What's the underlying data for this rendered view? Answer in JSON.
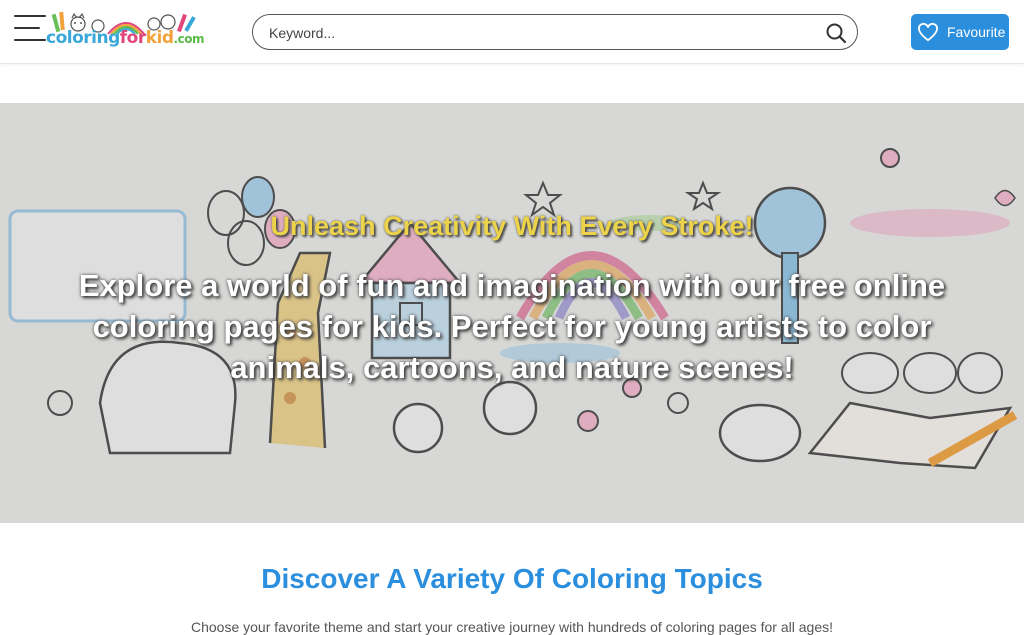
{
  "header": {
    "logo": {
      "text_parts": [
        "coloring",
        "for",
        "kid",
        ".com"
      ],
      "colors": [
        "#39a7d8",
        "#e0457b",
        "#f2a23a",
        "#58b947"
      ]
    },
    "search": {
      "placeholder": "Keyword...",
      "value": ""
    },
    "favourite_label": "Favourite"
  },
  "hero": {
    "tagline": "Unleash Creativity With Every Stroke!",
    "description": "Explore a world of fun and imagination with our free online coloring pages for kids. Perfect for young artists to color animals, cartoons, and nature scenes!"
  },
  "section": {
    "title": "Discover A Variety Of Coloring Topics",
    "subtitle": "Choose your favorite theme and start your creative journey with hundreds of coloring pages for all ages!"
  },
  "colors": {
    "accent": "#2b8fde",
    "tagline": "#ecd34a"
  }
}
